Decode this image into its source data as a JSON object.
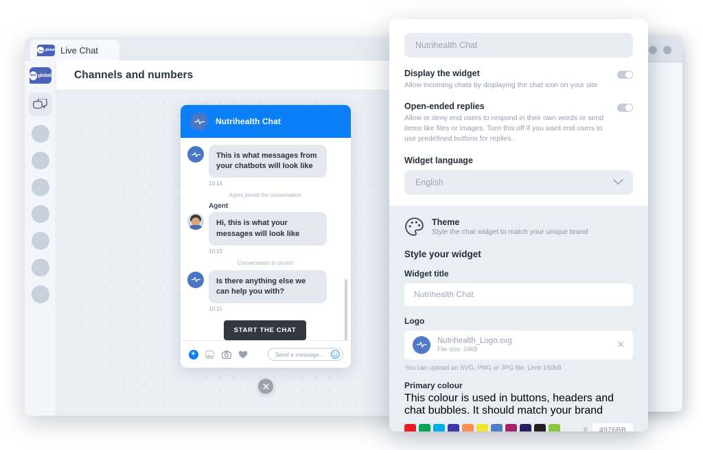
{
  "browser": {
    "tab_label": "Live Chat",
    "logo_bubble_text": "text",
    "logo_word": "global"
  },
  "app": {
    "rail_logo_bubble_text": "text",
    "rail_logo_word": "global",
    "rail_items": [
      "chat-icon",
      "placeholder-1",
      "placeholder-2",
      "placeholder-3",
      "placeholder-4",
      "placeholder-5",
      "placeholder-6",
      "placeholder-7"
    ],
    "header_title": "Channels and numbers"
  },
  "widget_preview": {
    "title": "Nutrihealth Chat",
    "messages": [
      {
        "kind": "bot",
        "text": "This is what messages from your chatbots will look like",
        "time": "10:14"
      },
      {
        "kind": "system",
        "text": "Agent joined the conversation"
      },
      {
        "kind": "agent",
        "sender": "Agent",
        "text": "Hi, this is what your messages will look like",
        "time": "10:15"
      },
      {
        "kind": "system",
        "text": "Conversation is closed"
      },
      {
        "kind": "bot",
        "text": "Is there anything else we can help you with?",
        "time": "10:15"
      }
    ],
    "cta_label": "START THE CHAT",
    "composer_placeholder": "Send a message...",
    "footer_icons": [
      "plus-icon",
      "gallery-icon",
      "camera-icon",
      "heart-icon",
      "emoji-icon"
    ],
    "close_fab": "close-icon"
  },
  "panel": {
    "name_field_value": "Nutrihealth Chat",
    "settings": [
      {
        "title": "Display the widget",
        "desc": "Allow incoming chats by displaying the chat icon on your site",
        "toggle_on": true
      },
      {
        "title": "Open-ended replies",
        "desc": "Allow or deny end users to respond in their own words or send items like files or images. Turn this off if you want end users to use predefined buttons for replies.",
        "toggle_on": true
      }
    ],
    "language_label": "Widget language",
    "language_value": "English",
    "theme": {
      "title": "Theme",
      "desc": "Style the chat widget to match your unique brand",
      "section_title": "Style your widget",
      "widget_title_label": "Widget title",
      "widget_title_value": "Nutrihealth Chat",
      "logo_label": "Logo",
      "logo_filename": "Nutrihealth_Logo.svg",
      "logo_filesize": "File size: 24kB",
      "logo_hint": "You can upload an SVG, PNG or JPG file. Limit 150kB",
      "primary_colour_label": "Primary colour",
      "primary_colour_desc": "This colour is used in buttons, headers and chat bubbles. It should match your brand",
      "swatches": [
        "#ed1c24",
        "#00a651",
        "#00adee",
        "#3b37a8",
        "#fb8e52",
        "#f5e42e",
        "#4d7fc4",
        "#a62167",
        "#28205e",
        "#231f20",
        "#8dc63f"
      ],
      "hex_symbol": "#",
      "hex_value": "4976BB"
    }
  },
  "colors": {
    "widget_header_blue": "#0b7ff7",
    "brand_blue": "#4a62b8",
    "cta_dark": "#333840"
  }
}
